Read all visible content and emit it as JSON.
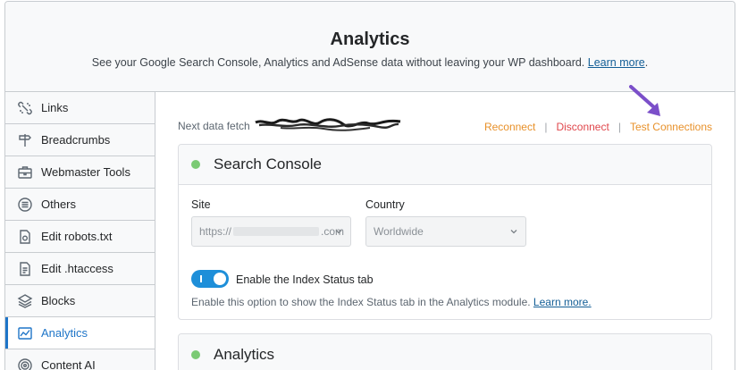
{
  "header": {
    "title": "Analytics",
    "subtitle": "See your Google Search Console, Analytics and AdSense data without leaving your WP dashboard.",
    "learn_more": "Learn more",
    "suffix": "."
  },
  "sidebar": {
    "items": [
      {
        "label": "Links",
        "icon": "links-icon"
      },
      {
        "label": "Breadcrumbs",
        "icon": "signpost-icon"
      },
      {
        "label": "Webmaster Tools",
        "icon": "toolbox-icon"
      },
      {
        "label": "Others",
        "icon": "list-circle-icon"
      },
      {
        "label": "Edit robots.txt",
        "icon": "robot-file-icon"
      },
      {
        "label": "Edit .htaccess",
        "icon": "document-icon"
      },
      {
        "label": "Blocks",
        "icon": "blocks-icon"
      },
      {
        "label": "Analytics",
        "icon": "chart-icon",
        "active": true
      },
      {
        "label": "Content AI",
        "icon": "content-ai-icon"
      }
    ]
  },
  "main": {
    "fetch_label": "Next data fetch",
    "actions": {
      "reconnect": "Reconnect",
      "disconnect": "Disconnect",
      "test": "Test Connections",
      "separator": "|"
    },
    "search_console": {
      "title": "Search Console",
      "site_label": "Site",
      "site_prefix": "https://",
      "site_suffix": ".com",
      "country_label": "Country",
      "country_value": "Worldwide",
      "toggle_label": "Enable the Index Status tab",
      "help_text": "Enable this option to show the Index Status tab in the Analytics module.",
      "help_link": "Learn more."
    },
    "analytics": {
      "title": "Analytics"
    }
  },
  "colors": {
    "accent": "#1e75c8",
    "orange": "#e8912a",
    "red": "#e0474c",
    "status_green": "#7bca74",
    "arrow": "#7b4fc9"
  }
}
